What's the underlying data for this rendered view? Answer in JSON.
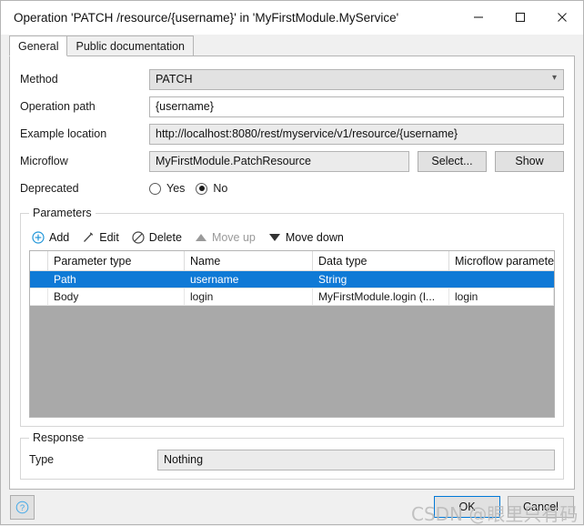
{
  "window": {
    "title": "Operation 'PATCH /resource/{username}' in 'MyFirstModule.MyService'",
    "minimize_label": "Minimize",
    "maximize_label": "Maximize",
    "close_label": "Close",
    "ghost_text": "···"
  },
  "tabs": [
    {
      "label": "General",
      "active": true
    },
    {
      "label": "Public documentation",
      "active": false
    }
  ],
  "general": {
    "method": {
      "label": "Method",
      "value": "PATCH"
    },
    "operation_path": {
      "label": "Operation path",
      "value": "{username}"
    },
    "example_location": {
      "label": "Example location",
      "value": "http://localhost:8080/rest/myservice/v1/resource/{username}"
    },
    "microflow": {
      "label": "Microflow",
      "value": "MyFirstModule.PatchResource",
      "select_label": "Select...",
      "show_label": "Show"
    },
    "deprecated": {
      "label": "Deprecated",
      "yes_label": "Yes",
      "no_label": "No",
      "selected": "No"
    }
  },
  "parameters": {
    "legend": "Parameters",
    "toolbar": [
      {
        "label": "Add",
        "icon": "plus-circle-icon",
        "disabled": false
      },
      {
        "label": "Edit",
        "icon": "pencil-icon",
        "disabled": false
      },
      {
        "label": "Delete",
        "icon": "no-entry-icon",
        "disabled": false
      },
      {
        "label": "Move up",
        "icon": "triangle-up-icon",
        "disabled": true
      },
      {
        "label": "Move down",
        "icon": "triangle-down-icon",
        "disabled": false
      }
    ],
    "columns": [
      "",
      "Parameter type",
      "Name",
      "Data type",
      "Microflow parameter"
    ],
    "rows": [
      {
        "selected": true,
        "cells": [
          "",
          "Path",
          "username",
          "String",
          ""
        ]
      },
      {
        "selected": false,
        "cells": [
          "",
          "Body",
          "login",
          "MyFirstModule.login (I...",
          "login"
        ]
      }
    ]
  },
  "response": {
    "legend": "Response",
    "type": {
      "label": "Type",
      "value": "Nothing"
    }
  },
  "footer": {
    "help_label": "?",
    "ok_label": "OK",
    "cancel_label": "Cancel"
  },
  "watermark": {
    "text": "CSDN @眼里只有码"
  },
  "colors": {
    "selection_blue": "#0f7ad6",
    "accent_blue": "#0078d7",
    "grid_empty_grey": "#a9a9a9",
    "readonly_field": "#ebebeb",
    "combo_field": "#e2e2e2",
    "disabled_text": "#9a9a9a"
  }
}
